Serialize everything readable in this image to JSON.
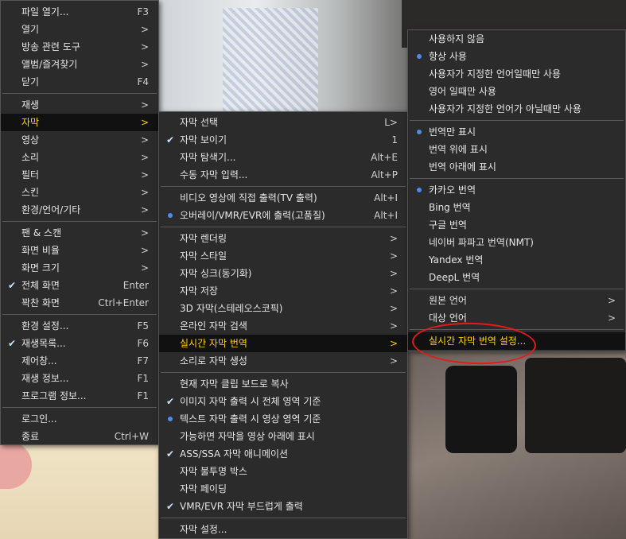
{
  "main_menu": [
    {
      "label": "파일 열기...",
      "shortcut": "F3"
    },
    {
      "label": "열기",
      "shortcut": ">"
    },
    {
      "label": "방송 관련 도구",
      "shortcut": ">"
    },
    {
      "label": "앨범/즐겨찾기",
      "shortcut": ">"
    },
    {
      "label": "닫기",
      "shortcut": "F4"
    },
    {
      "sep": true
    },
    {
      "label": "재생",
      "shortcut": ">"
    },
    {
      "label": "자막",
      "shortcut": ">",
      "highlight": true
    },
    {
      "label": "영상",
      "shortcut": ">"
    },
    {
      "label": "소리",
      "shortcut": ">"
    },
    {
      "label": "필터",
      "shortcut": ">"
    },
    {
      "label": "스킨",
      "shortcut": ">"
    },
    {
      "label": "환경/언어/기타",
      "shortcut": ">"
    },
    {
      "sep": true
    },
    {
      "label": "팬 & 스캔",
      "shortcut": ">"
    },
    {
      "label": "화면 비율",
      "shortcut": ">"
    },
    {
      "label": "화면 크기",
      "shortcut": ">"
    },
    {
      "label": "전체 화면",
      "shortcut": "Enter",
      "mark": "check"
    },
    {
      "label": "꽉찬 화면",
      "shortcut": "Ctrl+Enter"
    },
    {
      "sep": true
    },
    {
      "label": "환경 설정...",
      "shortcut": "F5"
    },
    {
      "label": "재생목록...",
      "shortcut": "F6",
      "mark": "check"
    },
    {
      "label": "제어창...",
      "shortcut": "F7"
    },
    {
      "label": "재생 정보...",
      "shortcut": "F1"
    },
    {
      "label": "프로그램 정보...",
      "shortcut": "F1"
    },
    {
      "sep": true
    },
    {
      "label": "로그인..."
    },
    {
      "label": "종료",
      "shortcut": "Ctrl+W"
    }
  ],
  "subtitle_menu": [
    {
      "label": "자막 선택",
      "shortcut": "L>"
    },
    {
      "label": "자막 보이기",
      "shortcut": "1",
      "mark": "check"
    },
    {
      "label": "자막 탐색기...",
      "shortcut": "Alt+E"
    },
    {
      "label": "수동 자막 입력...",
      "shortcut": "Alt+P"
    },
    {
      "sep": true
    },
    {
      "label": "비디오 영상에 직접 출력(TV 출력)",
      "shortcut": "Alt+I"
    },
    {
      "label": "오버레이/VMR/EVR에 출력(고품질)",
      "shortcut": "Alt+I",
      "mark": "dot"
    },
    {
      "sep": true
    },
    {
      "label": "자막 렌더링",
      "shortcut": ">"
    },
    {
      "label": "자막 스타일",
      "shortcut": ">"
    },
    {
      "label": "자막 싱크(동기화)",
      "shortcut": ">"
    },
    {
      "label": "자막 저장",
      "shortcut": ">"
    },
    {
      "label": "3D 자막(스테레오스코픽)",
      "shortcut": ">"
    },
    {
      "label": "온라인 자막 검색",
      "shortcut": ">"
    },
    {
      "label": "실시간 자막 번역",
      "shortcut": ">",
      "highlight": true
    },
    {
      "label": "소리로 자막 생성",
      "shortcut": ">"
    },
    {
      "sep": true
    },
    {
      "label": "현재 자막 클립 보드로 복사"
    },
    {
      "label": "이미지 자막 출력 시 전체 영역 기준",
      "mark": "check"
    },
    {
      "label": "텍스트 자막 출력 시 영상 영역 기준",
      "mark": "dot"
    },
    {
      "label": "가능하면 자막을 영상 아래에 표시"
    },
    {
      "label": "ASS/SSA 자막 애니메이션",
      "mark": "check"
    },
    {
      "label": "자막 불투명 박스"
    },
    {
      "label": "자막 페이딩"
    },
    {
      "label": "VMR/EVR 자막 부드럽게 출력",
      "mark": "check"
    },
    {
      "sep": true
    },
    {
      "label": "자막 설정..."
    }
  ],
  "translate_menu": [
    {
      "label": "사용하지 않음"
    },
    {
      "label": "항상 사용",
      "mark": "dot"
    },
    {
      "label": "사용자가 지정한 언어일때만 사용"
    },
    {
      "label": "영어 일때만 사용"
    },
    {
      "label": "사용자가 지정한 언어가 아닐때만 사용"
    },
    {
      "sep": true
    },
    {
      "label": "번역만 표시",
      "mark": "dot"
    },
    {
      "label": "번역 위에 표시"
    },
    {
      "label": "번역 아래에 표시"
    },
    {
      "sep": true
    },
    {
      "label": "카카오 번역",
      "mark": "dot"
    },
    {
      "label": "Bing 번역"
    },
    {
      "label": "구글 번역"
    },
    {
      "label": "네이버 파파고 번역(NMT)"
    },
    {
      "label": "Yandex 번역"
    },
    {
      "label": "DeepL 번역"
    },
    {
      "sep": true
    },
    {
      "label": "원본 언어",
      "shortcut": ">"
    },
    {
      "label": "대상 언어",
      "shortcut": ">"
    },
    {
      "sep": true
    },
    {
      "label": "실시간 자막 번역 설정...",
      "highlight": true
    }
  ]
}
